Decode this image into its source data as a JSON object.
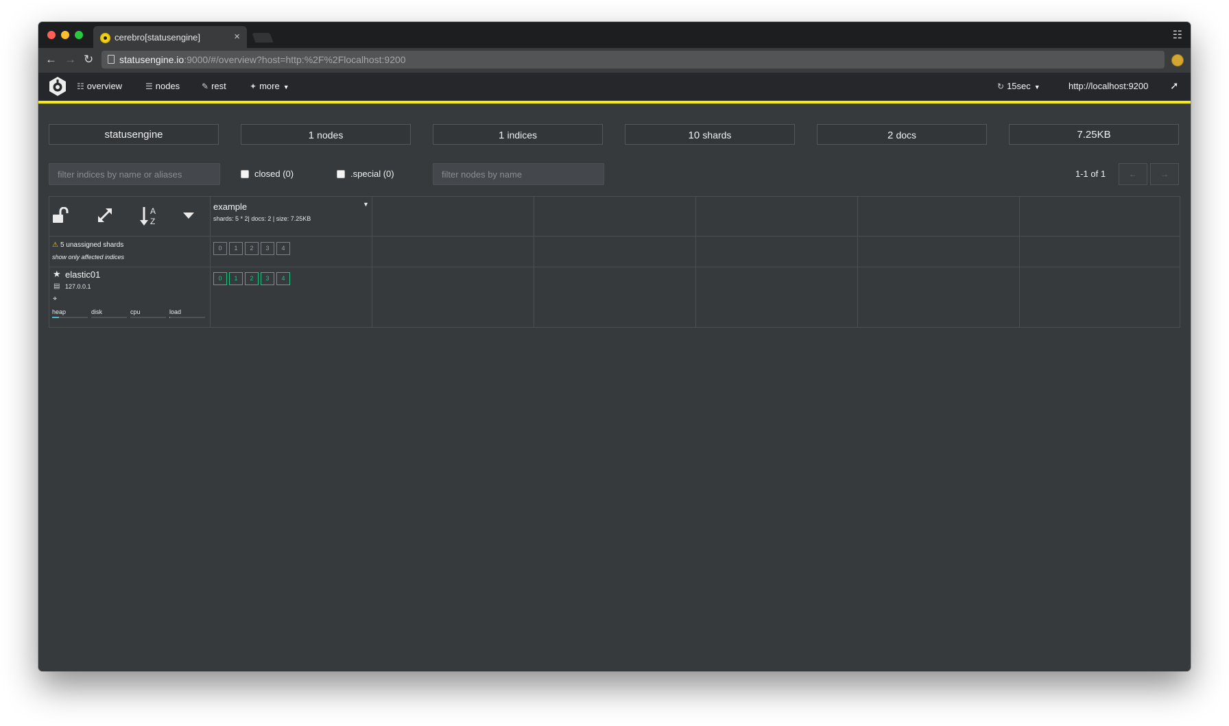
{
  "browser": {
    "tab_title": "cerebro[statusengine]",
    "tab_close": "×",
    "url_host": "statusengine.io",
    "url_rest": ":9000/#/overview?host=http:%2F%2Flocalhost:9200"
  },
  "nav": {
    "overview": "overview",
    "nodes": "nodes",
    "rest": "rest",
    "more": "more",
    "refresh": "15sec",
    "host": "http://localhost:9200"
  },
  "stats": {
    "cluster": "statusengine",
    "nodes_count": "1",
    "nodes_unit": "nodes",
    "indices_count": "1",
    "indices_unit": "indices",
    "shards_count": "10",
    "shards_unit": "shards",
    "docs_count": "2",
    "docs_unit": "docs",
    "size": "7.25KB"
  },
  "filters": {
    "indices_placeholder": "filter indices by name or aliases",
    "closed_label": "closed (0)",
    "special_label": ".special (0)",
    "nodes_placeholder": "filter nodes by name",
    "page_info": "1-1 of 1",
    "prev": "←",
    "next": "→"
  },
  "index": {
    "name": "example",
    "meta": "shards: 5 * 2| docs: 2 | size: 7.25KB"
  },
  "unassigned": {
    "text": "5 unassigned shards",
    "link": "show only affected indices",
    "shards": [
      "0",
      "1",
      "2",
      "3",
      "4"
    ]
  },
  "node": {
    "name": "elastic01",
    "ip": "127.0.0.1",
    "shards": [
      "0",
      "1",
      "2",
      "3",
      "4"
    ],
    "metrics": {
      "heap": "heap",
      "disk": "disk",
      "cpu": "cpu",
      "load": "load"
    },
    "levels": {
      "heap": 0.2,
      "disk": 0.0,
      "cpu": 0.0,
      "load": 0.02
    }
  },
  "colors": {
    "accent": "#f2ea10",
    "shard_started": "#21c27f",
    "warning": "#f0c419"
  }
}
